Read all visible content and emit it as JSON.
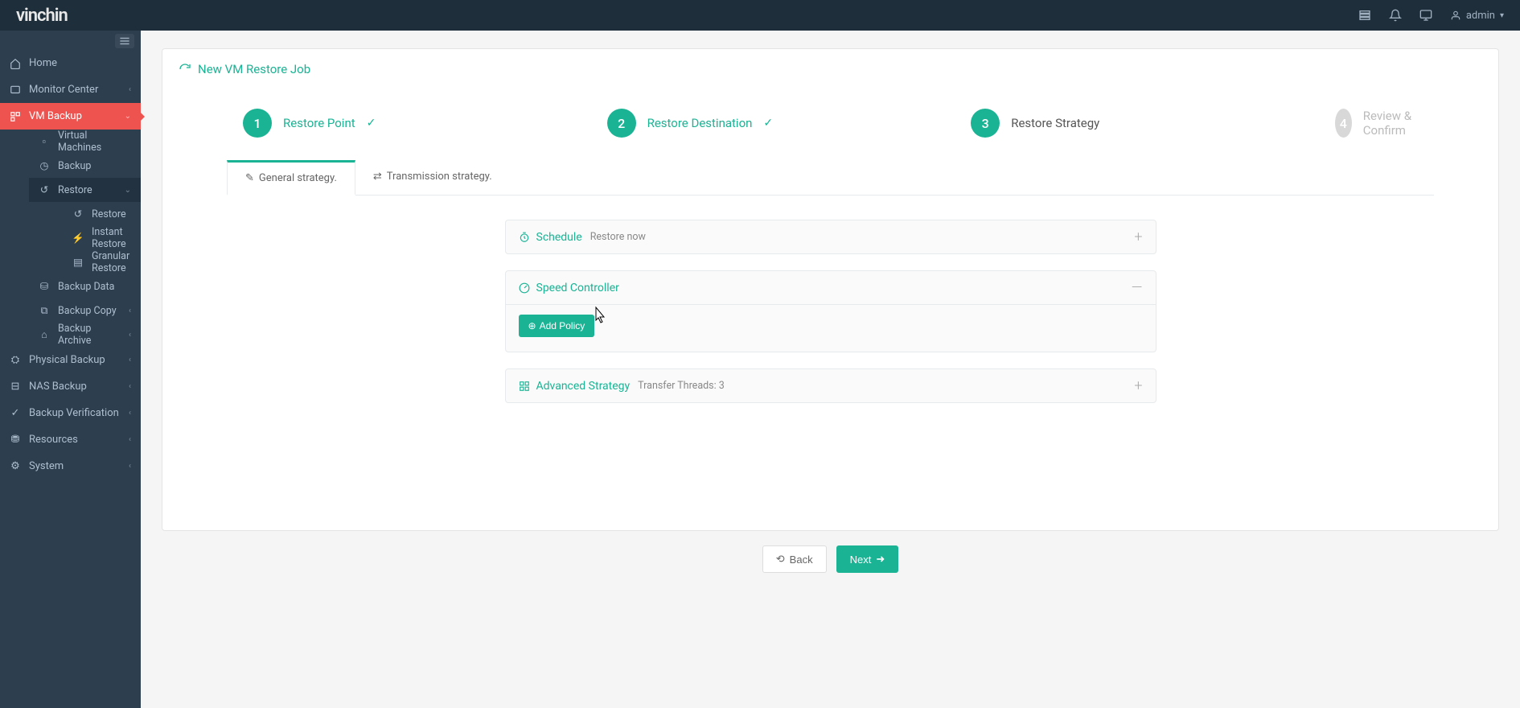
{
  "brand": "vinchin",
  "user": "admin",
  "page_title": "New VM Restore Job",
  "steps": [
    {
      "num": "1",
      "label": "Restore Point",
      "state": "done"
    },
    {
      "num": "2",
      "label": "Restore Destination",
      "state": "done"
    },
    {
      "num": "3",
      "label": "Restore Strategy",
      "state": "current"
    },
    {
      "num": "4",
      "label": "Review & Confirm",
      "state": "todo"
    }
  ],
  "tabs": {
    "general": "General strategy.",
    "transmission": "Transmission strategy."
  },
  "panels": {
    "schedule": {
      "title": "Schedule",
      "subtitle": "Restore now"
    },
    "speed": {
      "title": "Speed Controller",
      "add_policy": "Add Policy"
    },
    "advanced": {
      "title": "Advanced Strategy",
      "subtitle": "Transfer Threads: 3"
    }
  },
  "sidebar": {
    "home": "Home",
    "monitor": "Monitor Center",
    "vmbackup": "VM Backup",
    "vm_items": {
      "virtual_machines": "Virtual Machines",
      "backup": "Backup",
      "restore_parent": "Restore",
      "restore": "Restore",
      "instant_restore": "Instant Restore",
      "granular_restore": "Granular Restore",
      "backup_data": "Backup Data",
      "backup_copy": "Backup Copy",
      "backup_archive": "Backup Archive"
    },
    "physical": "Physical Backup",
    "nas": "NAS Backup",
    "verification": "Backup Verification",
    "resources": "Resources",
    "system": "System"
  },
  "buttons": {
    "back": "Back",
    "next": "Next"
  }
}
